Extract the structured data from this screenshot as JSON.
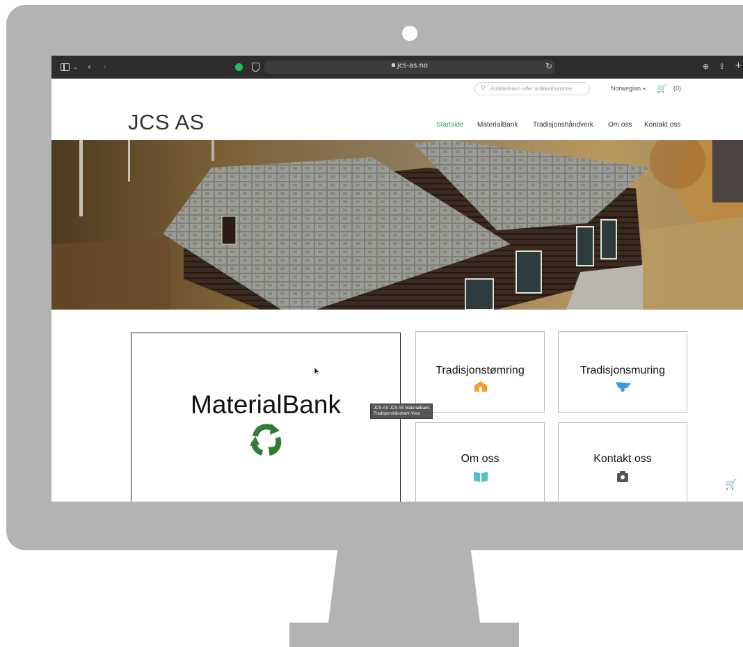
{
  "browser": {
    "url": "jcs-as.no",
    "icons": [
      "sidebar-icon",
      "chevron-down-icon",
      "back-icon",
      "forward-icon",
      "grammarly-icon",
      "shield-icon",
      "lock-icon",
      "reload-icon",
      "download-icon",
      "share-icon",
      "new-tab-icon"
    ]
  },
  "header": {
    "search_placeholder": "Artikkelnavn eller artikkelnummer",
    "language": "Norwegian",
    "cart_count": "(0)",
    "site_title": "JCS AS"
  },
  "nav": {
    "items": [
      {
        "label": "Startside",
        "active": true
      },
      {
        "label": "MaterialBank",
        "active": false
      },
      {
        "label": "Tradisjonshåndverk",
        "active": false
      },
      {
        "label": "Om oss",
        "active": false
      },
      {
        "label": "Kontakt oss",
        "active": false
      }
    ],
    "active_color": "#2aa84a"
  },
  "tiles": {
    "materialbank": {
      "label": "MaterialBank",
      "icon": "recycle-icon"
    },
    "tradisjonstomring": {
      "label": "Tradisjonstømring",
      "icon": "house-icon"
    },
    "tradisjonsmuring": {
      "label": "Tradisjonsmuring",
      "icon": "wheelbarrow-icon"
    },
    "om_oss": {
      "label": "Om oss",
      "icon": "book-icon"
    },
    "kontakt_oss": {
      "label": "Kontakt oss",
      "icon": "contact-icon"
    }
  },
  "tooltip": "JCS-AS JCS AS MaterialBank\nTradisjonshåndverk Voss",
  "colors": {
    "frame": "#b3b3b3",
    "recycle": "#2e7d32",
    "house": "#f0a030",
    "wheelbarrow": "#3a9ad9",
    "book": "#4fc3c8"
  }
}
